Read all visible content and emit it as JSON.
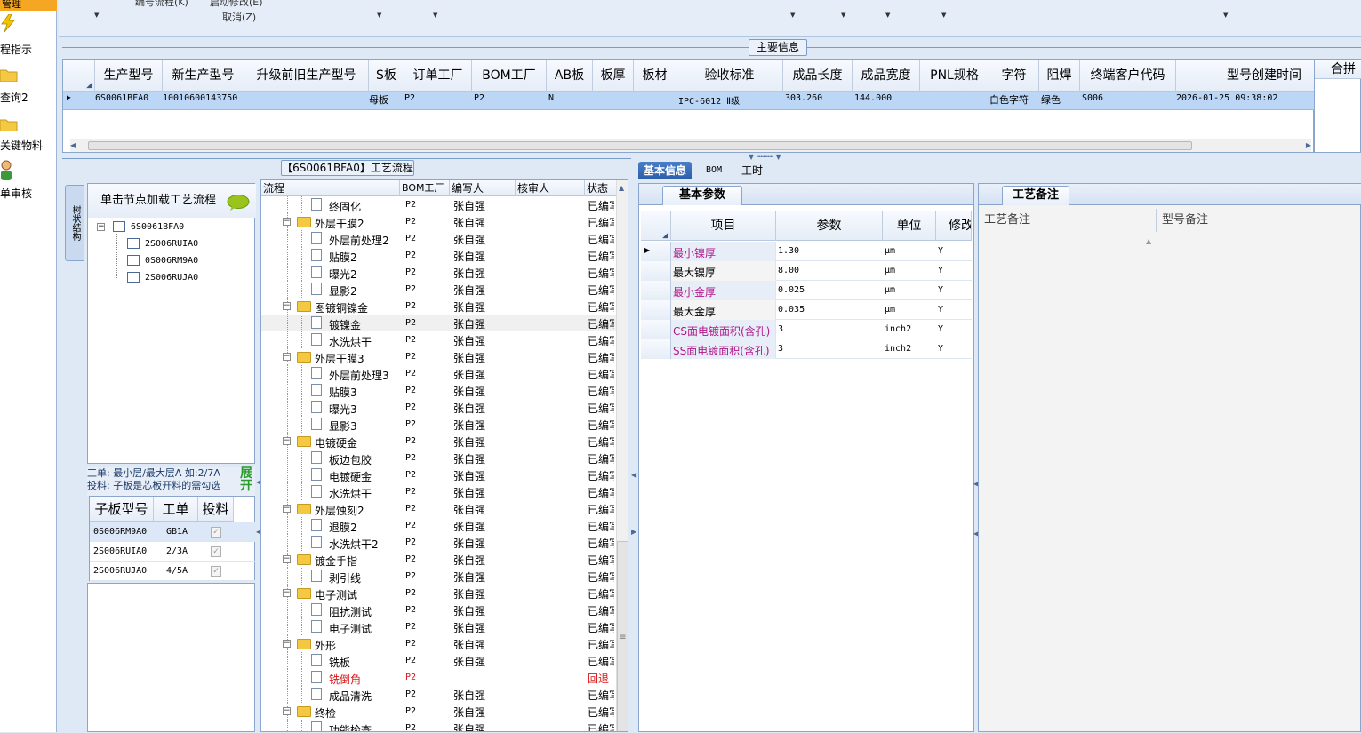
{
  "nav": {
    "items": [
      {
        "label": "管理",
        "icon": "selected-bar"
      },
      {
        "label": "程指示",
        "icon": "lightning-icon"
      },
      {
        "label": "查询2",
        "icon": "folder-icon"
      },
      {
        "label": "关键物料",
        "icon": "folder-icon"
      },
      {
        "label": "单审核",
        "icon": "user-icon"
      }
    ]
  },
  "toolbar": {
    "item1": "编号流程(K)",
    "item2": "启动修改(E)",
    "item3": "取消(Z)"
  },
  "main": {
    "group_label": "主要信息",
    "right_stub_header": "合拼",
    "columns": [
      "生产型号",
      "新生产型号",
      "升级前旧生产型号",
      "S板",
      "订单工厂",
      "BOM工厂",
      "AB板",
      "板厚",
      "板材",
      "验收标准",
      "成品长度",
      "成品宽度",
      "PNL规格",
      "字符",
      "阻焊",
      "终端客户代码",
      "型号创建时间"
    ],
    "row": {
      "model": "6S0061BFA0",
      "new_model": "10010600143750",
      "sboard": "母板",
      "order_factory": "P2",
      "bom_factory": "P2",
      "ab": "N",
      "standard": "IPC-6012 Ⅱ级",
      "length": "303.260",
      "width": "144.000",
      "char": "白色字符",
      "solder": "绿色",
      "customer": "S006",
      "created": "2026-01-25 09:38:02"
    }
  },
  "left": {
    "vtab": "树状结构",
    "tree_header": "单击节点加载工艺流程",
    "tree": [
      "6S0061BFA0",
      "2S006RUIA0",
      "0S006RM9A0",
      "2S006RUJA0"
    ],
    "hint1": "工单: 最小层/最大层A 如:2/7A",
    "hint2": "投料: 子板是芯板开料的需勾选",
    "expand": "展开",
    "sub_columns": [
      "子板型号",
      "工单",
      "投料"
    ],
    "sub_rows": [
      {
        "model": "0S006RM9A0",
        "order": "GB1A"
      },
      {
        "model": "2S006RUIA0",
        "order": "2/3A"
      },
      {
        "model": "2S006RUJA0",
        "order": "4/5A"
      }
    ]
  },
  "flow": {
    "title": "【6S0061BFA0】工艺流程",
    "columns": [
      "流程",
      "BOM工厂",
      "编写人",
      "核审人",
      "状态"
    ],
    "rows": [
      {
        "name": "终固化",
        "type": "doc",
        "factory": "P2",
        "writer": "张自强",
        "status": "已编写"
      },
      {
        "name": "外层干膜2",
        "type": "folder",
        "factory": "P2",
        "writer": "张自强",
        "status": "已编写"
      },
      {
        "name": "外层前处理2",
        "type": "doc",
        "factory": "P2",
        "writer": "张自强",
        "status": "已编写"
      },
      {
        "name": "贴膜2",
        "type": "doc",
        "factory": "P2",
        "writer": "张自强",
        "status": "已编写"
      },
      {
        "name": "曝光2",
        "type": "doc",
        "factory": "P2",
        "writer": "张自强",
        "status": "已编写"
      },
      {
        "name": "显影2",
        "type": "doc",
        "factory": "P2",
        "writer": "张自强",
        "status": "已编写"
      },
      {
        "name": "图镀铜镍金",
        "type": "folder",
        "factory": "P2",
        "writer": "张自强",
        "status": "已编写"
      },
      {
        "name": "镀镍金",
        "type": "doc",
        "factory": "P2",
        "writer": "张自强",
        "status": "已编写"
      },
      {
        "name": "水洗烘干",
        "type": "doc",
        "factory": "P2",
        "writer": "张自强",
        "status": "已编写"
      },
      {
        "name": "外层干膜3",
        "type": "folder",
        "factory": "P2",
        "writer": "张自强",
        "status": "已编写"
      },
      {
        "name": "外层前处理3",
        "type": "doc",
        "factory": "P2",
        "writer": "张自强",
        "status": "已编写"
      },
      {
        "name": "贴膜3",
        "type": "doc",
        "factory": "P2",
        "writer": "张自强",
        "status": "已编写"
      },
      {
        "name": "曝光3",
        "type": "doc",
        "factory": "P2",
        "writer": "张自强",
        "status": "已编写"
      },
      {
        "name": "显影3",
        "type": "doc",
        "factory": "P2",
        "writer": "张自强",
        "status": "已编写"
      },
      {
        "name": "电镀硬金",
        "type": "folder",
        "factory": "P2",
        "writer": "张自强",
        "status": "已编写"
      },
      {
        "name": "板边包胶",
        "type": "doc",
        "factory": "P2",
        "writer": "张自强",
        "status": "已编写"
      },
      {
        "name": "电镀硬金",
        "type": "doc",
        "factory": "P2",
        "writer": "张自强",
        "status": "已编写"
      },
      {
        "name": "水洗烘干",
        "type": "doc",
        "factory": "P2",
        "writer": "张自强",
        "status": "已编写"
      },
      {
        "name": "外层蚀刻2",
        "type": "folder",
        "factory": "P2",
        "writer": "张自强",
        "status": "已编写"
      },
      {
        "name": "退膜2",
        "type": "doc",
        "factory": "P2",
        "writer": "张自强",
        "status": "已编写"
      },
      {
        "name": "水洗烘干2",
        "type": "doc",
        "factory": "P2",
        "writer": "张自强",
        "status": "已编写"
      },
      {
        "name": "镀金手指",
        "type": "folder",
        "factory": "P2",
        "writer": "张自强",
        "status": "已编写"
      },
      {
        "name": "剥引线",
        "type": "doc",
        "factory": "P2",
        "writer": "张自强",
        "status": "已编写"
      },
      {
        "name": "电子测试",
        "type": "folder",
        "factory": "P2",
        "writer": "张自强",
        "status": "已编写"
      },
      {
        "name": "阻抗测试",
        "type": "doc",
        "factory": "P2",
        "writer": "张自强",
        "status": "已编写"
      },
      {
        "name": "电子测试",
        "type": "doc",
        "factory": "P2",
        "writer": "张自强",
        "status": "已编写"
      },
      {
        "name": "外形",
        "type": "folder",
        "factory": "P2",
        "writer": "张自强",
        "status": "已编写"
      },
      {
        "name": "铣板",
        "type": "doc",
        "factory": "P2",
        "writer": "张自强",
        "status": "已编写"
      },
      {
        "name": "铣倒角",
        "type": "doc",
        "factory": "P2",
        "writer": "",
        "status": "回退"
      },
      {
        "name": "成品清洗",
        "type": "doc",
        "factory": "P2",
        "writer": "张自强",
        "status": "已编写"
      },
      {
        "name": "终检",
        "type": "folder",
        "factory": "P2",
        "writer": "张自强",
        "status": "已编写"
      },
      {
        "name": "功能检查",
        "type": "doc",
        "factory": "P2",
        "writer": "张自强",
        "status": "已编写"
      }
    ]
  },
  "right": {
    "tabs": [
      "基本信息",
      "BOM",
      "工时"
    ],
    "param_tab": "基本参数",
    "param_columns": [
      "项目",
      "参数",
      "单位",
      "修改"
    ],
    "params": [
      {
        "item": "最小镍厚",
        "value": "1.30",
        "unit": "μm",
        "mod": "Y",
        "hl": true
      },
      {
        "item": "最大镍厚",
        "value": "8.00",
        "unit": "μm",
        "mod": "Y",
        "hl": false
      },
      {
        "item": "最小金厚",
        "value": "0.025",
        "unit": "μm",
        "mod": "Y",
        "hl": true
      },
      {
        "item": "最大金厚",
        "value": "0.035",
        "unit": "μm",
        "mod": "Y",
        "hl": false
      },
      {
        "item": "CS面电镀面积(含孔)",
        "value": "3",
        "unit": "inch2",
        "mod": "Y",
        "hl": true
      },
      {
        "item": "SS面电镀面积(含孔)",
        "value": "3",
        "unit": "inch2",
        "mod": "Y",
        "hl": true
      }
    ],
    "note_tab": "工艺备注",
    "note_columns": [
      "工艺备注",
      "型号备注"
    ]
  },
  "colors": {
    "accent": "#2a5ea8",
    "selected_row": "#bcd6f5",
    "purple": "#b0188a",
    "red": "#d81818"
  }
}
